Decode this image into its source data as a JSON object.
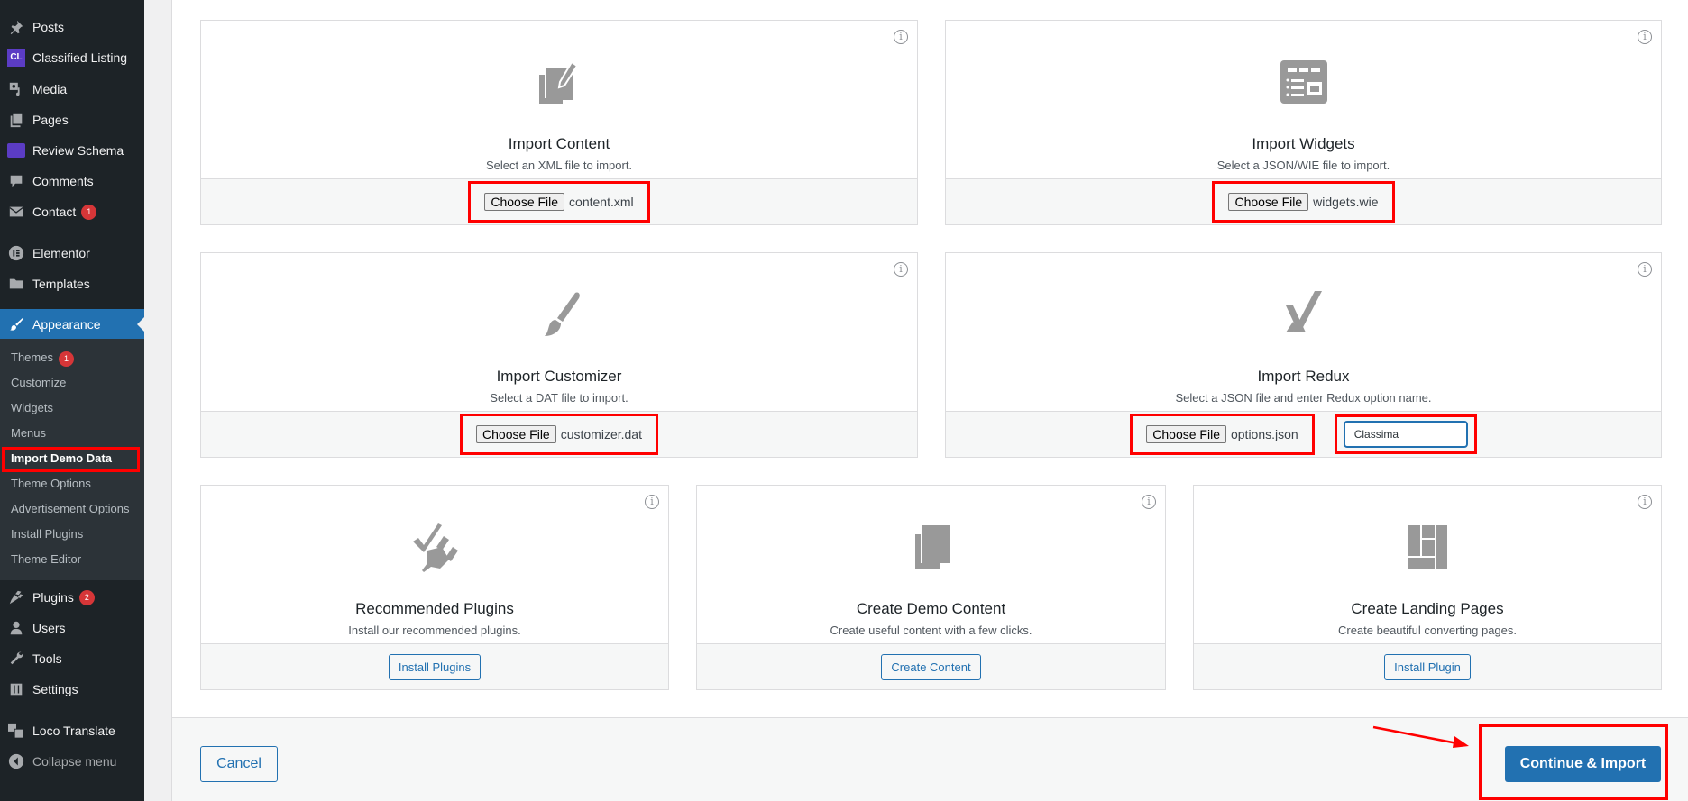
{
  "sidebar": {
    "items": [
      {
        "label": "Posts",
        "icon": "pin-icon"
      },
      {
        "label": "Classified Listing",
        "icon": "cl-logo-icon"
      },
      {
        "label": "Media",
        "icon": "media-icon"
      },
      {
        "label": "Pages",
        "icon": "pages-icon"
      },
      {
        "label": "Review Schema",
        "icon": "review-schema-icon"
      },
      {
        "label": "Comments",
        "icon": "comment-icon"
      },
      {
        "label": "Contact",
        "icon": "mail-icon",
        "badge": "1"
      },
      {
        "label": "Elementor",
        "icon": "elementor-icon"
      },
      {
        "label": "Templates",
        "icon": "folder-icon"
      },
      {
        "label": "Appearance",
        "icon": "paintbrush-icon"
      },
      {
        "label": "Plugins",
        "icon": "plugin-icon",
        "badge": "2"
      },
      {
        "label": "Users",
        "icon": "user-icon"
      },
      {
        "label": "Tools",
        "icon": "wrench-icon"
      },
      {
        "label": "Settings",
        "icon": "settings-icon"
      },
      {
        "label": "Loco Translate",
        "icon": "translate-icon"
      },
      {
        "label": "Collapse menu",
        "icon": "collapse-icon"
      }
    ],
    "submenu": [
      {
        "label": "Themes",
        "badge": "1"
      },
      {
        "label": "Customize"
      },
      {
        "label": "Widgets"
      },
      {
        "label": "Menus"
      },
      {
        "label": "Import Demo Data",
        "current": true
      },
      {
        "label": "Theme Options"
      },
      {
        "label": "Advertisement Options"
      },
      {
        "label": "Install Plugins"
      },
      {
        "label": "Theme Editor"
      }
    ]
  },
  "cards": [
    {
      "title": "Import Content",
      "desc": "Select an XML file to import.",
      "button": "Choose File",
      "file": "content.xml",
      "icon": "edit-page-icon"
    },
    {
      "title": "Import Widgets",
      "desc": "Select a JSON/WIE file to import.",
      "button": "Choose File",
      "file": "widgets.wie",
      "icon": "widgets-icon"
    },
    {
      "title": "Import Customizer",
      "desc": "Select a DAT file to import.",
      "button": "Choose File",
      "file": "customizer.dat",
      "icon": "brush-icon"
    },
    {
      "title": "Import Redux",
      "desc": "Select a JSON file and enter Redux option name.",
      "button": "Choose File",
      "file": "options.json",
      "option_name": "Classima",
      "icon": "redux-icon"
    },
    {
      "title": "Recommended Plugins",
      "desc": "Install our recommended plugins.",
      "button": "Install Plugins",
      "icon": "plugin-check-icon"
    },
    {
      "title": "Create Demo Content",
      "desc": "Create useful content with a few clicks.",
      "button": "Create Content",
      "icon": "copy-icon"
    },
    {
      "title": "Create Landing Pages",
      "desc": "Create beautiful converting pages.",
      "button": "Install Plugin",
      "icon": "layout-icon"
    }
  ],
  "info_glyph": "i",
  "footer": {
    "cancel": "Cancel",
    "continue": "Continue & Import"
  },
  "colors": {
    "accent": "#2271b1",
    "sidebar_bg": "#1d2327",
    "highlight": "#ff0000",
    "badge": "#d63638"
  }
}
